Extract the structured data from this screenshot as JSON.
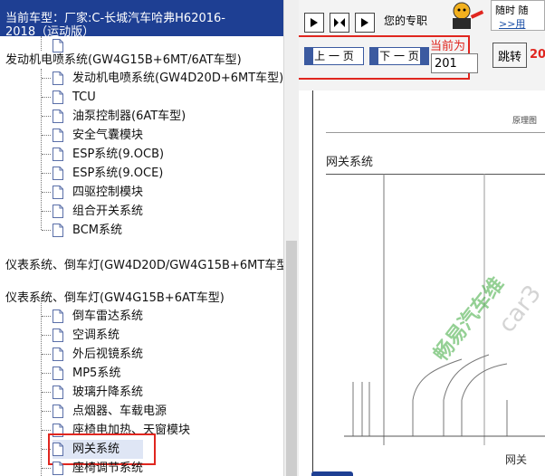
{
  "left_panel": {
    "vehicle_header": "当前车型：厂家:C-长城汽车哈弗H62016-\n2018（运动版）",
    "tree": {
      "row0_label": "",
      "group1_label": "发动机电喷系统(GW4G15B+6MT/6AT车型)",
      "group1_items": [
        "发动机电喷系统(GW4D20D+6MT车型)",
        "TCU",
        "油泵控制器(6AT车型)",
        "安全气囊模块",
        "ESP系统(9.OCB)",
        "ESP系统(9.OCE)",
        "四驱控制模块",
        "组合开关系统",
        "BCM系统"
      ],
      "group2_label": "仪表系统、倒车灯(GW4D20D/GW4G15B+6MT车型",
      "group3_label": "仪表系统、倒车灯(GW4G15B+6AT车型)",
      "group3_items": [
        "倒车雷达系统",
        "空调系统",
        "外后视镜系统",
        "MP5系统",
        "玻璃升降系统",
        "点烟器、车载电源",
        "座椅电加热、天窗模块",
        "网关系统",
        "座椅调节系统"
      ],
      "selected_item": "网关系统"
    }
  },
  "right_panel": {
    "toolbar": {
      "promo_text": "您的专职",
      "promo_box_line1": "随时 随",
      "promo_link": ">>用"
    },
    "nav": {
      "prev_label": "上 一 页",
      "next_label": "下 一 页",
      "current_label": "当前为",
      "page_value": "201",
      "jump_label": "跳转",
      "jump_page": "20"
    },
    "document": {
      "header_label": "原理图",
      "title": "网关系统",
      "footer": "网关",
      "watermark_green": "畅易汽车维",
      "watermark_gray": "car3"
    }
  },
  "colors": {
    "header_bg": "#1e3f93",
    "highlight_red": "#e0261f",
    "nav_blue": "#3b5aa0"
  }
}
